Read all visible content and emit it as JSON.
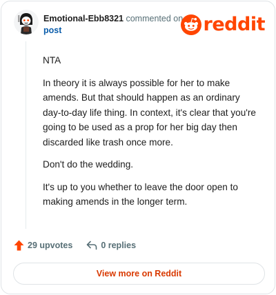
{
  "header": {
    "username": "Emotional-Ebb8321",
    "action_text": "commented on",
    "post_link": "post",
    "brand": "reddit",
    "brand_color": "#ff4500",
    "avatar_icon": "snoo-avatar-icon"
  },
  "comment": {
    "paragraphs": [
      "NTA",
      "In theory it is always possible for her to make amends. But that should happen as an ordinary day-to-day life thing. In context, it's clear that you're going to be used as a prop for her big day then discarded like trash once more.",
      "Don't do the wedding.",
      "It's up to you whether to leave the door open to making amends in the longer term."
    ]
  },
  "actions": {
    "upvotes": "29 upvotes",
    "upvote_icon": "upvote-arrow-icon",
    "upvote_color": "#ff4500",
    "replies": "0 replies",
    "reply_icon": "reply-arrow-icon"
  },
  "footer": {
    "view_more": "View more on Reddit",
    "link_color": "#d93900"
  }
}
